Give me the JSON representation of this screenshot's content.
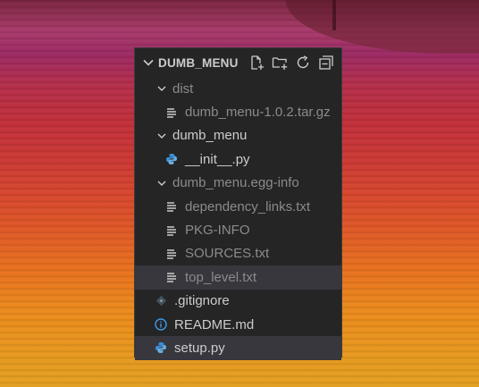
{
  "explorer": {
    "title": "DUMB_MENU",
    "actions": [
      {
        "name": "new-file-icon"
      },
      {
        "name": "new-folder-icon"
      },
      {
        "name": "refresh-icon"
      },
      {
        "name": "collapse-all-icon"
      }
    ],
    "tree": [
      {
        "label": "dist",
        "kind": "folder",
        "depth": 1,
        "muted": true
      },
      {
        "label": "dumb_menu-1.0.2.tar.gz",
        "kind": "text",
        "depth": 2,
        "muted": true
      },
      {
        "label": "dumb_menu",
        "kind": "folder",
        "depth": 1,
        "muted": false
      },
      {
        "label": "__init__.py",
        "kind": "python",
        "depth": 2,
        "muted": false
      },
      {
        "label": "dumb_menu.egg-info",
        "kind": "folder",
        "depth": 1,
        "muted": true
      },
      {
        "label": "dependency_links.txt",
        "kind": "text",
        "depth": 2,
        "muted": true
      },
      {
        "label": "PKG-INFO",
        "kind": "text",
        "depth": 2,
        "muted": true
      },
      {
        "label": "SOURCES.txt",
        "kind": "text",
        "depth": 2,
        "muted": true
      },
      {
        "label": "top_level.txt",
        "kind": "text",
        "depth": 2,
        "muted": true,
        "hover": true
      },
      {
        "label": ".gitignore",
        "kind": "git",
        "depth": 1,
        "muted": false
      },
      {
        "label": "README.md",
        "kind": "info",
        "depth": 1,
        "muted": false
      },
      {
        "label": "setup.py",
        "kind": "python",
        "depth": 1,
        "muted": false,
        "selected": true
      }
    ]
  },
  "colors": {
    "panel_bg": "#252526",
    "muted_text": "#8b8b8b",
    "text": "#cccccc",
    "python_blue": "#3b8fd8",
    "info_blue": "#3c9be8",
    "selected_bg": "#37373d"
  }
}
